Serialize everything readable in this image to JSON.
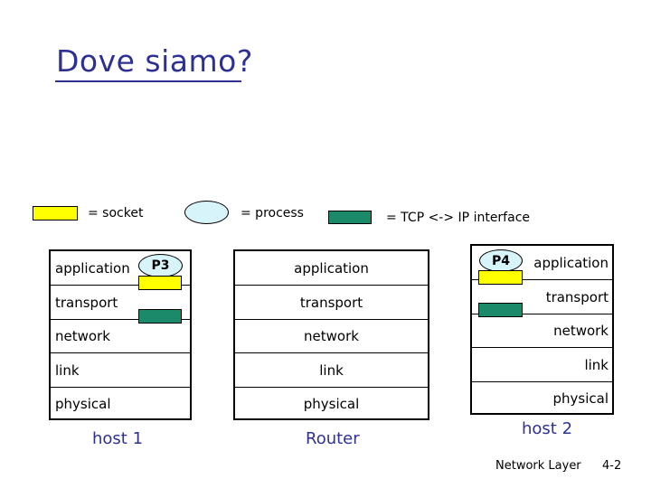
{
  "slide": {
    "title": "Dove siamo?",
    "footer_label": "Network Layer",
    "page_number": "4-2"
  },
  "legend": {
    "socket": "= socket",
    "process": "= process",
    "tcp_ip": "= TCP <-> IP interface",
    "colors": {
      "socket": "#ffff00",
      "process": "#d8f4fb",
      "tcp_ip": "#1a8a6a"
    }
  },
  "host1": {
    "name": "host 1",
    "layers": [
      "application",
      "transport",
      "network",
      "link",
      "physical"
    ],
    "process": "P3"
  },
  "router": {
    "name": "Router",
    "layers": [
      "application",
      "transport",
      "network",
      "link",
      "physical"
    ]
  },
  "host2": {
    "name": "host 2",
    "layers": [
      "application",
      "transport",
      "network",
      "link",
      "physical"
    ],
    "process": "P4"
  }
}
